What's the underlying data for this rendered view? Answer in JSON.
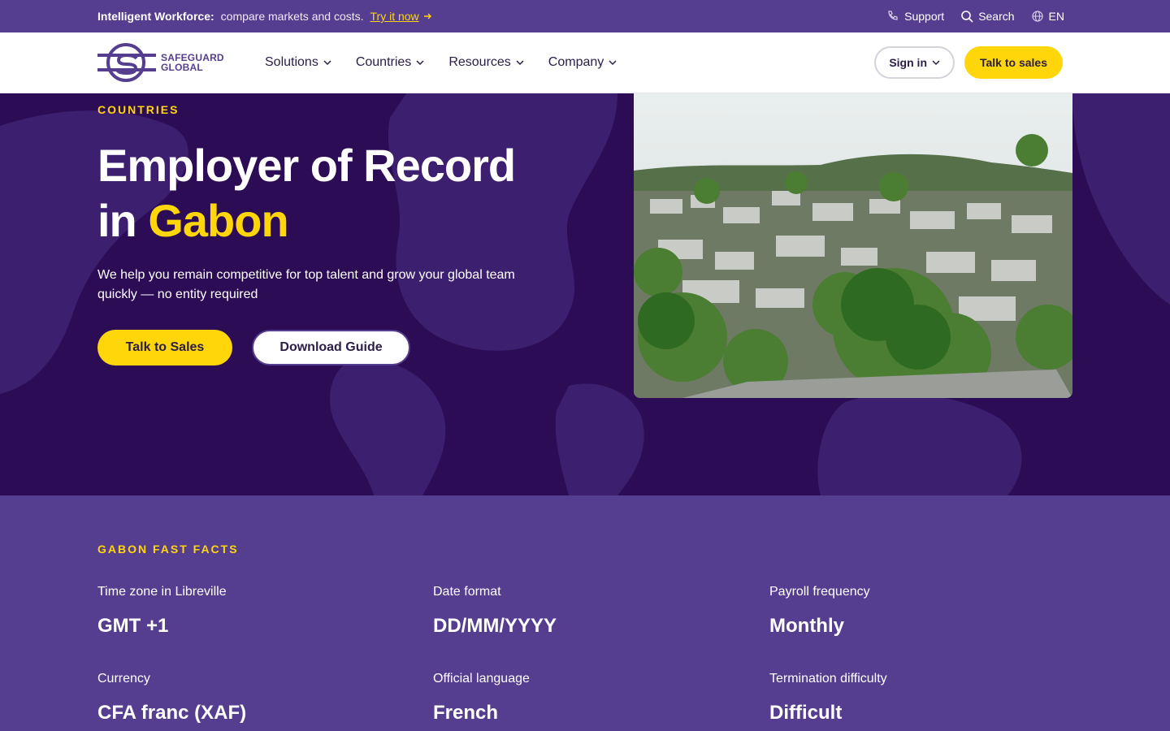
{
  "announcement": {
    "bold": "Intelligent Workforce:",
    "text": "compare markets and costs.",
    "link": "Try it now",
    "support": "Support",
    "search": "Search",
    "language": "EN"
  },
  "nav": {
    "logo_line1": "SAFEGUARD",
    "logo_line2": "GLOBAL",
    "menu": [
      "Solutions",
      "Countries",
      "Resources",
      "Company"
    ],
    "signin": "Sign in",
    "talk_to_sales": "Talk to sales"
  },
  "hero": {
    "eyebrow": "COUNTRIES",
    "title_line1": "Employer of Record",
    "title_in": "in",
    "title_country": "Gabon",
    "lead": "We help you remain competitive for top talent and grow your global team quickly — no entity required",
    "primary_cta": "Talk to Sales",
    "secondary_cta": "Download Guide"
  },
  "facts": {
    "heading": "GABON FAST FACTS",
    "items": [
      {
        "label": "Time zone in Libreville",
        "value": "GMT +1"
      },
      {
        "label": "Date format",
        "value": "DD/MM/YYYY"
      },
      {
        "label": "Payroll frequency",
        "value": "Monthly"
      },
      {
        "label": "Currency",
        "value": "CFA franc (XAF)"
      },
      {
        "label": "Official language",
        "value": "French"
      },
      {
        "label": "Termination difficulty",
        "value": "Difficult"
      }
    ]
  },
  "colors": {
    "brand_purple": "#553e8f",
    "dark_purple": "#2b0c55",
    "accent_yellow": "#ffd60a"
  },
  "icons": [
    "arrow-right-icon",
    "phone-icon",
    "search-icon",
    "globe-icon",
    "chevron-down-icon",
    "logo-icon"
  ]
}
